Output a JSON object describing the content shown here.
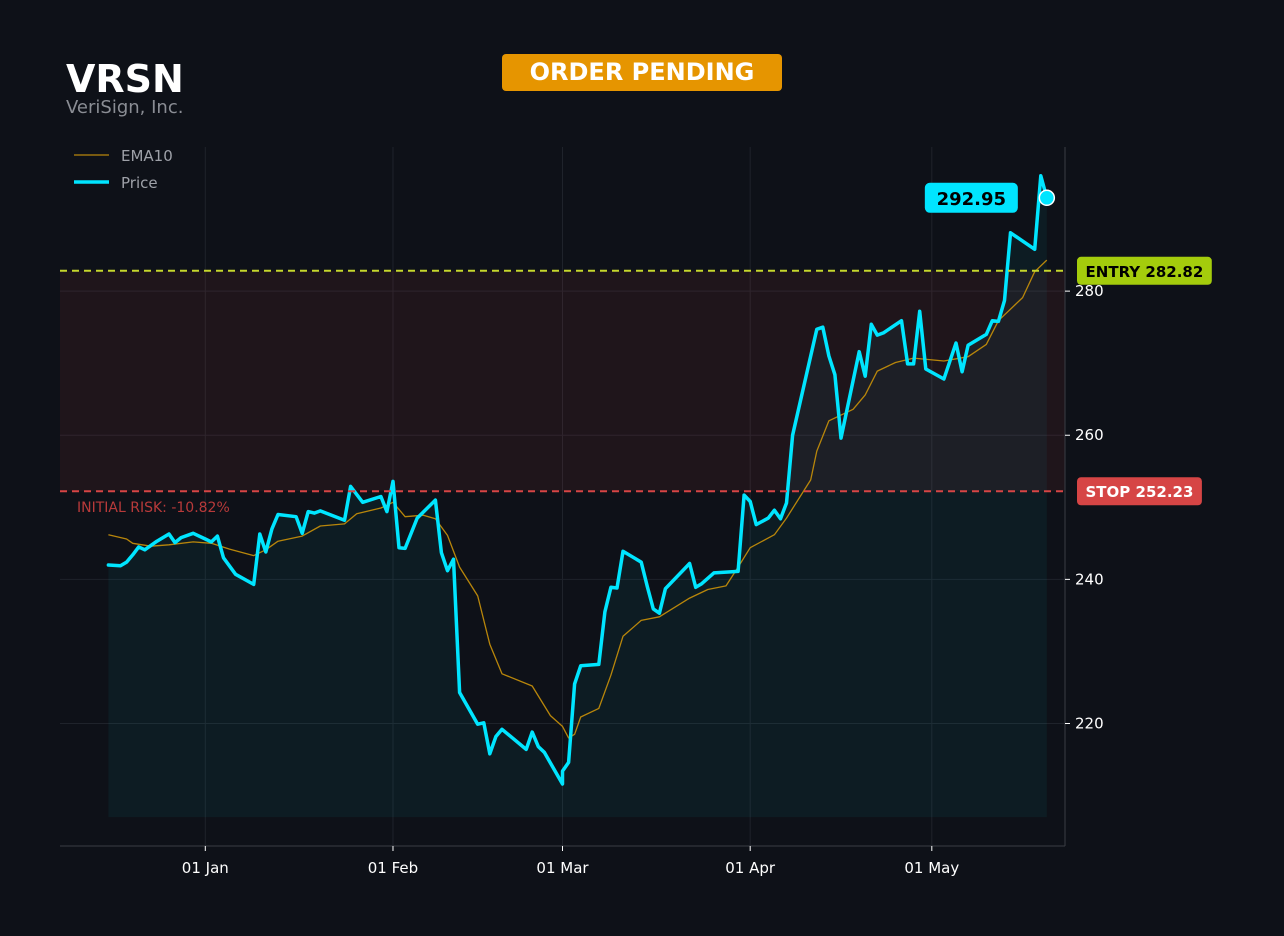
{
  "header": {
    "ticker": "VRSN",
    "company": "VeriSign, Inc.",
    "status_badge": "ORDER PENDING"
  },
  "colors": {
    "background": "#0e1118",
    "price": "#00e5ff",
    "ema": "#b8860b",
    "entry": "#c6d62c",
    "stop": "#d64545",
    "badge": "#e69500",
    "entry_tag": "#a4cc0c",
    "stop_tag": "#d64545"
  },
  "chart_data": {
    "type": "line",
    "legend": [
      "EMA10",
      "Price"
    ],
    "legend_position": "top-left",
    "grid": true,
    "xlim": [
      "2024-12-08",
      "2025-05-23"
    ],
    "ylim": [
      203,
      300
    ],
    "x_ticks": [
      {
        "date": "2025-01-01",
        "label": "01 Jan"
      },
      {
        "date": "2025-02-01",
        "label": "01 Feb"
      },
      {
        "date": "2025-03-01",
        "label": "01 Mar"
      },
      {
        "date": "2025-04-01",
        "label": "01 Apr"
      },
      {
        "date": "2025-05-01",
        "label": "01 May"
      }
    ],
    "y_ticks": [
      220,
      240,
      260,
      280
    ],
    "series": [
      {
        "name": "Price",
        "points": [
          [
            "2024-12-16",
            242.0
          ],
          [
            "2024-12-18",
            241.9
          ],
          [
            "2024-12-19",
            242.4
          ],
          [
            "2024-12-20",
            243.4
          ],
          [
            "2024-12-21",
            244.5
          ],
          [
            "2024-12-22",
            244.1
          ],
          [
            "2024-12-24",
            245.3
          ],
          [
            "2024-12-26",
            246.3
          ],
          [
            "2024-12-27",
            245.1
          ],
          [
            "2024-12-28",
            245.8
          ],
          [
            "2024-12-30",
            246.4
          ],
          [
            "2025-01-01",
            245.6
          ],
          [
            "2025-01-02",
            245.2
          ],
          [
            "2025-01-03",
            246.0
          ],
          [
            "2025-01-04",
            243.0
          ],
          [
            "2025-01-06",
            240.7
          ],
          [
            "2025-01-09",
            239.3
          ],
          [
            "2025-01-10",
            246.3
          ],
          [
            "2025-01-11",
            243.8
          ],
          [
            "2025-01-12",
            247.0
          ],
          [
            "2025-01-13",
            249.0
          ],
          [
            "2025-01-16",
            248.7
          ],
          [
            "2025-01-17",
            246.4
          ],
          [
            "2025-01-18",
            249.4
          ],
          [
            "2025-01-19",
            249.2
          ],
          [
            "2025-01-20",
            249.5
          ],
          [
            "2025-01-24",
            248.2
          ],
          [
            "2025-01-25",
            252.9
          ],
          [
            "2025-01-27",
            250.7
          ],
          [
            "2025-01-30",
            251.5
          ],
          [
            "2025-01-31",
            249.4
          ],
          [
            "2025-02-01",
            253.6
          ],
          [
            "2025-02-02",
            244.4
          ],
          [
            "2025-02-03",
            244.3
          ],
          [
            "2025-02-05",
            248.5
          ],
          [
            "2025-02-08",
            251.0
          ],
          [
            "2025-02-09",
            243.7
          ],
          [
            "2025-02-10",
            241.2
          ],
          [
            "2025-02-11",
            242.8
          ],
          [
            "2025-02-12",
            224.3
          ],
          [
            "2025-02-15",
            219.9
          ],
          [
            "2025-02-16",
            220.1
          ],
          [
            "2025-02-17",
            215.8
          ],
          [
            "2025-02-18",
            218.2
          ],
          [
            "2025-02-19",
            219.2
          ],
          [
            "2025-02-23",
            216.4
          ],
          [
            "2025-02-24",
            218.8
          ],
          [
            "2025-02-25",
            216.8
          ],
          [
            "2025-02-26",
            216.0
          ],
          [
            "2025-02-29",
            211.6
          ],
          [
            "2025-03-01",
            213.4
          ],
          [
            "2025-03-02",
            214.6
          ],
          [
            "2025-03-03",
            225.5
          ],
          [
            "2025-03-04",
            228.0
          ],
          [
            "2025-03-07",
            228.2
          ],
          [
            "2025-03-08",
            235.5
          ],
          [
            "2025-03-09",
            238.9
          ],
          [
            "2025-03-10",
            238.8
          ],
          [
            "2025-03-11",
            243.9
          ],
          [
            "2025-03-14",
            242.4
          ],
          [
            "2025-03-15",
            239.0
          ],
          [
            "2025-03-16",
            235.9
          ],
          [
            "2025-03-17",
            235.3
          ],
          [
            "2025-03-18",
            238.7
          ],
          [
            "2025-03-22",
            242.2
          ],
          [
            "2025-03-23",
            238.9
          ],
          [
            "2025-03-24",
            239.4
          ],
          [
            "2025-03-26",
            240.9
          ],
          [
            "2025-03-30",
            241.1
          ],
          [
            "2025-03-31",
            251.7
          ],
          [
            "2025-04-01",
            250.8
          ],
          [
            "2025-04-02",
            247.6
          ],
          [
            "2025-04-04",
            248.5
          ],
          [
            "2025-04-05",
            249.6
          ],
          [
            "2025-04-06",
            248.4
          ],
          [
            "2025-04-07",
            250.6
          ],
          [
            "2025-04-08",
            260.0
          ],
          [
            "2025-04-12",
            274.7
          ],
          [
            "2025-04-13",
            275.0
          ],
          [
            "2025-04-14",
            271.0
          ],
          [
            "2025-04-15",
            268.4
          ],
          [
            "2025-04-16",
            259.6
          ],
          [
            "2025-04-19",
            271.6
          ],
          [
            "2025-04-20",
            268.2
          ],
          [
            "2025-04-21",
            275.4
          ],
          [
            "2025-04-22",
            273.9
          ],
          [
            "2025-04-23",
            274.2
          ],
          [
            "2025-04-26",
            275.9
          ],
          [
            "2025-04-27",
            269.9
          ],
          [
            "2025-04-28",
            269.9
          ],
          [
            "2025-04-29",
            277.2
          ],
          [
            "2025-04-30",
            269.2
          ],
          [
            "2025-05-03",
            267.8
          ],
          [
            "2025-05-05",
            272.8
          ],
          [
            "2025-05-06",
            268.8
          ],
          [
            "2025-05-07",
            272.5
          ],
          [
            "2025-05-09",
            273.5
          ],
          [
            "2025-05-10",
            274.0
          ],
          [
            "2025-05-11",
            275.9
          ],
          [
            "2025-05-12",
            275.8
          ],
          [
            "2025-05-13",
            278.7
          ],
          [
            "2025-05-14",
            288.1
          ],
          [
            "2025-05-18",
            285.8
          ],
          [
            "2025-05-19",
            296.0
          ],
          [
            "2025-05-20",
            292.95
          ]
        ]
      },
      {
        "name": "EMA10",
        "points": [
          [
            "2024-12-16",
            246.2
          ],
          [
            "2024-12-19",
            245.6
          ],
          [
            "2024-12-20",
            245.0
          ],
          [
            "2024-12-23",
            244.6
          ],
          [
            "2024-12-26",
            244.8
          ],
          [
            "2024-12-30",
            245.2
          ],
          [
            "2025-01-02",
            245.0
          ],
          [
            "2025-01-05",
            244.2
          ],
          [
            "2025-01-09",
            243.3
          ],
          [
            "2025-01-11",
            244.1
          ],
          [
            "2025-01-13",
            245.3
          ],
          [
            "2025-01-17",
            246.0
          ],
          [
            "2025-01-20",
            247.4
          ],
          [
            "2025-01-24",
            247.7
          ],
          [
            "2025-01-26",
            249.1
          ],
          [
            "2025-01-30",
            249.9
          ],
          [
            "2025-02-01",
            250.7
          ],
          [
            "2025-02-03",
            248.7
          ],
          [
            "2025-02-06",
            248.9
          ],
          [
            "2025-02-08",
            248.4
          ],
          [
            "2025-02-10",
            246.1
          ],
          [
            "2025-02-12",
            241.7
          ],
          [
            "2025-02-15",
            237.7
          ],
          [
            "2025-02-17",
            231.0
          ],
          [
            "2025-02-19",
            226.9
          ],
          [
            "2025-02-24",
            225.2
          ],
          [
            "2025-02-27",
            221.1
          ],
          [
            "2025-03-01",
            219.6
          ],
          [
            "2025-03-02",
            218.0
          ],
          [
            "2025-03-03",
            218.5
          ],
          [
            "2025-03-04",
            220.9
          ],
          [
            "2025-03-07",
            222.1
          ],
          [
            "2025-03-09",
            226.7
          ],
          [
            "2025-03-11",
            232.1
          ],
          [
            "2025-03-14",
            234.3
          ],
          [
            "2025-03-17",
            234.8
          ],
          [
            "2025-03-22",
            237.4
          ],
          [
            "2025-03-25",
            238.6
          ],
          [
            "2025-03-28",
            239.1
          ],
          [
            "2025-03-30",
            241.7
          ],
          [
            "2025-04-01",
            244.4
          ],
          [
            "2025-04-05",
            246.2
          ],
          [
            "2025-04-07",
            248.5
          ],
          [
            "2025-04-11",
            253.8
          ],
          [
            "2025-04-12",
            257.8
          ],
          [
            "2025-04-14",
            262.0
          ],
          [
            "2025-04-18",
            263.6
          ],
          [
            "2025-04-20",
            265.6
          ],
          [
            "2025-04-22",
            268.9
          ],
          [
            "2025-04-25",
            270.1
          ],
          [
            "2025-04-28",
            270.7
          ],
          [
            "2025-05-03",
            270.3
          ],
          [
            "2025-05-07",
            270.9
          ],
          [
            "2025-05-10",
            272.6
          ],
          [
            "2025-05-12",
            275.9
          ],
          [
            "2025-05-16",
            279.1
          ],
          [
            "2025-05-18",
            282.7
          ],
          [
            "2025-05-20",
            284.3
          ]
        ]
      }
    ],
    "reference_lines": [
      {
        "name": "ENTRY",
        "value": 282.82,
        "label": "ENTRY 282.82"
      },
      {
        "name": "STOP",
        "value": 252.23,
        "label": "STOP 252.23"
      }
    ],
    "annotations": {
      "last_price": "292.95",
      "risk": "INITIAL RISK: -10.82%"
    }
  }
}
